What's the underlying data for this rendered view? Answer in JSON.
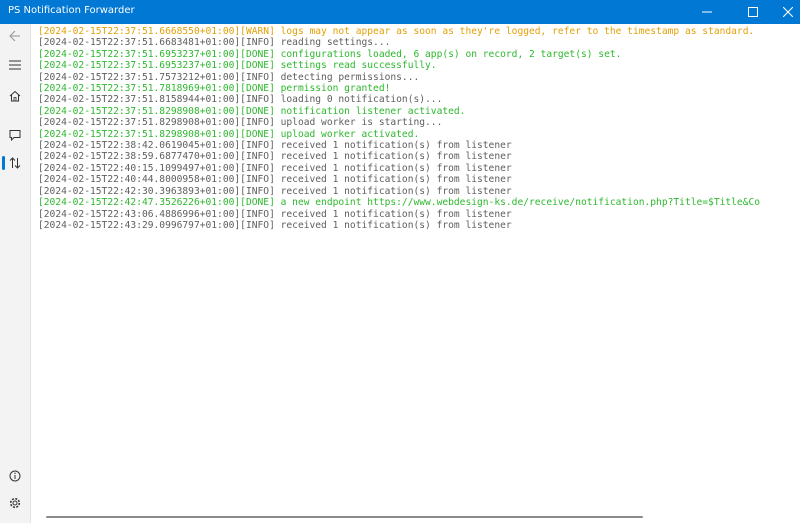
{
  "app": {
    "title": "PS Notification Forwarder"
  },
  "window_controls": {
    "minimize_icon": "minimize-icon",
    "maximize_icon": "maximize-icon",
    "close_icon": "close-icon"
  },
  "nav": {
    "items": [
      {
        "name": "back",
        "icon": "back-arrow-icon"
      },
      {
        "name": "menu",
        "icon": "hamburger-icon"
      },
      {
        "name": "home",
        "icon": "home-icon"
      },
      {
        "name": "messages",
        "icon": "chat-icon"
      },
      {
        "name": "log",
        "icon": "transfer-icon",
        "active": true
      },
      {
        "name": "about",
        "icon": "info-icon"
      },
      {
        "name": "settings",
        "icon": "gear-icon"
      }
    ]
  },
  "colors": {
    "titlebar": "#0078d4",
    "warn": "#e3a008",
    "done": "#2eb82e",
    "info": "#5f5f5f"
  },
  "log": [
    {
      "ts": "2024-02-15T22:37:51.6668550+01:00",
      "level": "WARN",
      "msg": "logs may not appear as soon as they're logged, refer to the timestamp as standard."
    },
    {
      "ts": "2024-02-15T22:37:51.6683481+01:00",
      "level": "INFO",
      "msg": "reading settings..."
    },
    {
      "ts": "2024-02-15T22:37:51.6953237+01:00",
      "level": "DONE",
      "msg": "configurations loaded, 6 app(s) on record, 2 target(s) set."
    },
    {
      "ts": "2024-02-15T22:37:51.6953237+01:00",
      "level": "DONE",
      "msg": "settings read successfully."
    },
    {
      "ts": "2024-02-15T22:37:51.7573212+01:00",
      "level": "INFO",
      "msg": "detecting permissions..."
    },
    {
      "ts": "2024-02-15T22:37:51.7818969+01:00",
      "level": "DONE",
      "msg": "permission granted!"
    },
    {
      "ts": "2024-02-15T22:37:51.8158944+01:00",
      "level": "INFO",
      "msg": "loading 0 notification(s)..."
    },
    {
      "ts": "2024-02-15T22:37:51.8298908+01:00",
      "level": "DONE",
      "msg": "notification listener activated."
    },
    {
      "ts": "2024-02-15T22:37:51.8298908+01:00",
      "level": "INFO",
      "msg": "upload worker is starting..."
    },
    {
      "ts": "2024-02-15T22:37:51.8298908+01:00",
      "level": "DONE",
      "msg": "upload worker activated."
    },
    {
      "ts": "2024-02-15T22:38:42.0619045+01:00",
      "level": "INFO",
      "msg": "received 1 notification(s) from listener"
    },
    {
      "ts": "2024-02-15T22:38:59.6877470+01:00",
      "level": "INFO",
      "msg": "received 1 notification(s) from listener"
    },
    {
      "ts": "2024-02-15T22:40:15.1099497+01:00",
      "level": "INFO",
      "msg": "received 1 notification(s) from listener"
    },
    {
      "ts": "2024-02-15T22:40:44.8000958+01:00",
      "level": "INFO",
      "msg": "received 1 notification(s) from listener"
    },
    {
      "ts": "2024-02-15T22:42:30.3963893+01:00",
      "level": "INFO",
      "msg": "received 1 notification(s) from listener"
    },
    {
      "ts": "2024-02-15T22:42:47.3526226+01:00",
      "level": "DONE",
      "msg": "a new endpoint https://www.webdesign-ks.de/receive/notification.php?Title=$Title&Co"
    },
    {
      "ts": "2024-02-15T22:43:06.4886996+01:00",
      "level": "INFO",
      "msg": "received 1 notification(s) from listener"
    },
    {
      "ts": "2024-02-15T22:43:29.0996797+01:00",
      "level": "INFO",
      "msg": "received 1 notification(s) from listener"
    }
  ]
}
